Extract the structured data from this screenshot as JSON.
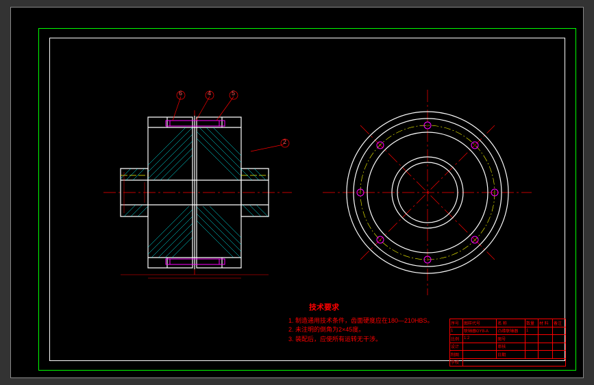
{
  "colors": {
    "frame": "#00ff00",
    "inner_frame": "#ffffff",
    "outline": "#ffffff",
    "centerline": "#ff0000",
    "hatch": "#00ffff",
    "detail": "#ff00ff",
    "phantom": "#ffff00",
    "text": "#ff0000"
  },
  "balloons": [
    "6",
    "4",
    "5",
    "2"
  ],
  "notes": {
    "title": "技术要求",
    "lines": [
      "1. 制造通用技术条件，齿面硬度应在180—210HBS。",
      "2. 未注明的倒角为2×45度。",
      "3. 装配后，应使所有运转无干涉。"
    ]
  },
  "titleblock": {
    "rows": [
      [
        "序号",
        "图样代号",
        "名 称",
        "数量",
        "材 料",
        "备注"
      ],
      [
        "1",
        "联轴器GY8-A",
        "凸缘联轴器",
        "1",
        "",
        ""
      ],
      [
        "比例",
        "1:2",
        "图号",
        "",
        "",
        ""
      ],
      [
        "设计",
        "",
        "审核",
        "",
        "",
        ""
      ],
      [
        "制图",
        "",
        "日期",
        "",
        "",
        ""
      ],
      [
        "学校",
        "",
        "",
        "",
        "",
        ""
      ]
    ]
  },
  "chart_data": {
    "type": "table",
    "description": "CAD mechanical drawing - flange coupling (凸缘联轴器 GY8-A), section view (left) and front elevation (right)",
    "views": [
      {
        "name": "section",
        "position": "left",
        "features": [
          "shaft_bore",
          "flange_face",
          "bolt_holes",
          "keyway",
          "hatching"
        ]
      },
      {
        "name": "front",
        "position": "right",
        "features": [
          "outer_circle",
          "bolt_circle",
          "bore_circle",
          "bolt_holes_count_8",
          "centerlines"
        ]
      }
    ],
    "balloon_items": [
      {
        "num": "6",
        "ref": "part"
      },
      {
        "num": "4",
        "ref": "part"
      },
      {
        "num": "5",
        "ref": "part"
      },
      {
        "num": "2",
        "ref": "part"
      }
    ]
  }
}
